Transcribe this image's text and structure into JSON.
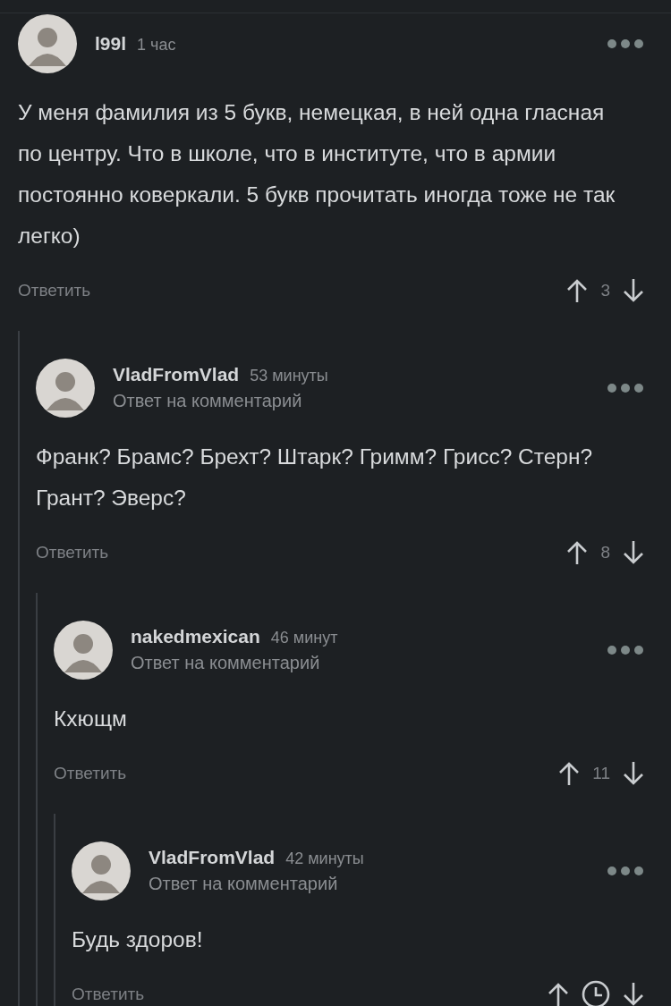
{
  "comments": [
    {
      "author": "l99l",
      "time": "1 час",
      "text": "У меня фамилия из 5 букв, немецкая, в ней одна гласная по центру. Что в школе, что в институте, что в армии постоянно коверкали. 5 букв прочитать иногда тоже не так легко)",
      "reply": "Ответить",
      "rating": {
        "kind": "score",
        "value": "3"
      },
      "children": [
        {
          "author": "VladFromVlad",
          "time": "53 минуты",
          "reply_to": "Ответ на комментарий",
          "text": "Франк? Брамс? Брехт? Штарк? Гримм? Грисс? Стерн? Грант? Эверс?",
          "reply": "Ответить",
          "rating": {
            "kind": "score",
            "value": "8"
          },
          "children": [
            {
              "author": "nakedmexican",
              "time": "46 минут",
              "reply_to": "Ответ на комментарий",
              "text": "Кхющм",
              "reply": "Ответить",
              "rating": {
                "kind": "score",
                "value": "11"
              },
              "children": [
                {
                  "author": "VladFromVlad",
                  "time": "42 минуты",
                  "reply_to": "Ответ на комментарий",
                  "text": "Будь здоров!",
                  "reply": "Ответить",
                  "rating": {
                    "kind": "pending"
                  }
                }
              ]
            }
          ]
        }
      ]
    }
  ]
}
